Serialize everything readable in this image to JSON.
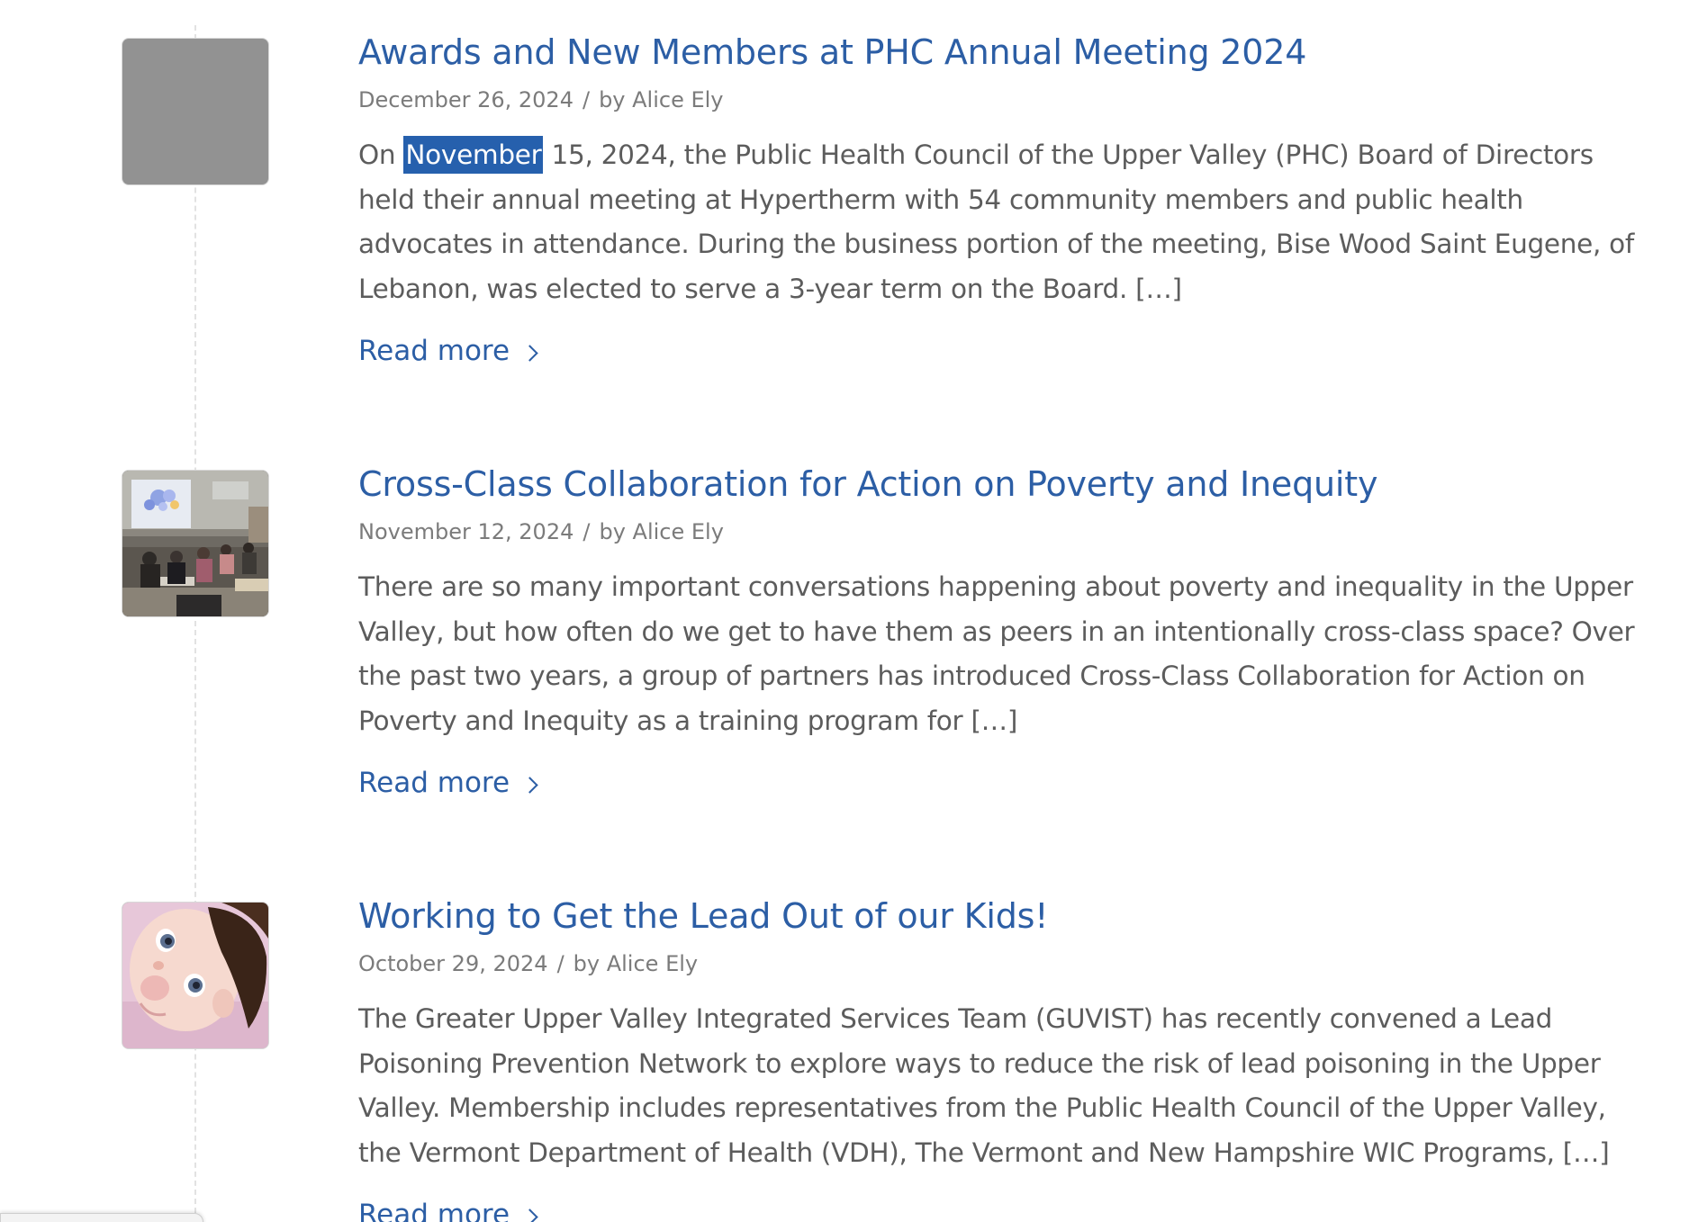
{
  "colors": {
    "link": "#2c5ea5",
    "meta": "#7b7b7b",
    "body_text": "#5c5c5c",
    "selection": "#2660ad",
    "placeholder_thumb": "#929292"
  },
  "posts": [
    {
      "title": "Awards and New Members at PHC Annual Meeting 2024",
      "date": "December 26, 2024",
      "separator": "/",
      "author": "by Alice Ely",
      "excerpt_before": "On ",
      "excerpt_highlight": "November",
      "excerpt_after": " 15, 2024, the Public Health Council of the Upper Valley (PHC) Board of Directors held their annual meeting at Hypertherm with 54 community members and public health advocates in attendance. During the business portion of the meeting, Bise Wood Saint Eugene, of Lebanon, was elected to serve a 3-year term on the Board. […]",
      "read_more": "Read more",
      "thumbnail": "placeholder"
    },
    {
      "title": "Cross-Class Collaboration for Action on Poverty and Inequity",
      "date": "November 12, 2024",
      "separator": "/",
      "author": "by Alice Ely",
      "excerpt": "There are so many important conversations happening about poverty and inequality in the Upper Valley, but how often do we get to have them as peers in an intentionally cross-class space? Over the past two years, a group of partners has introduced Cross-Class Collaboration for Action on Poverty and Inequity as a training program for […]",
      "read_more": "Read more",
      "thumbnail": "meeting-room-photo"
    },
    {
      "title": "Working to Get the Lead Out of our Kids!",
      "date": "October 29, 2024",
      "separator": "/",
      "author": "by Alice Ely",
      "excerpt": "The Greater Upper Valley Integrated Services Team (GUVIST) has recently convened a Lead Poisoning Prevention Network to explore ways to reduce the risk of lead poisoning in the Upper Valley.  Membership includes representatives from the Public Health Council of the Upper Valley, the Vermont Department of Health (VDH), The Vermont and New Hampshire WIC Programs, […]",
      "read_more": "Read more",
      "thumbnail": "baby-photo"
    }
  ]
}
